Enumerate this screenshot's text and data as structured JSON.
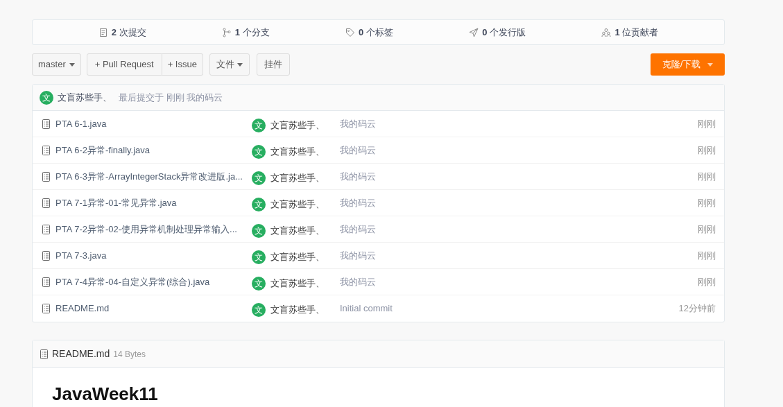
{
  "stats": [
    {
      "kind": "commits",
      "count": "2",
      "label": "次提交"
    },
    {
      "kind": "branches",
      "count": "1",
      "label": "个分支"
    },
    {
      "kind": "tags",
      "count": "0",
      "label": "个标签"
    },
    {
      "kind": "releases",
      "count": "0",
      "label": "个发行版"
    },
    {
      "kind": "contributors",
      "count": "1",
      "label": "位贡献者"
    }
  ],
  "toolbar": {
    "branch": "master",
    "pull_request": "+ Pull Request",
    "issue": "+ Issue",
    "files": "文件",
    "widgets": "挂件",
    "clone": "克隆/下载"
  },
  "last_commit": {
    "avatar": "文",
    "author": "文盲苏些手、",
    "info": "最后提交于 刚刚 我的码云"
  },
  "files": [
    {
      "name": "PTA 6-1.java",
      "avatar": "文",
      "author": "文盲苏些手、",
      "message": "我的码云",
      "time": "刚刚"
    },
    {
      "name": "PTA 6-2异常-finally.java",
      "avatar": "文",
      "author": "文盲苏些手、",
      "message": "我的码云",
      "time": "刚刚"
    },
    {
      "name": "PTA 6-3异常-ArrayIntegerStack异常改进版.ja...",
      "avatar": "文",
      "author": "文盲苏些手、",
      "message": "我的码云",
      "time": "刚刚"
    },
    {
      "name": "PTA 7-1异常-01-常见异常.java",
      "avatar": "文",
      "author": "文盲苏些手、",
      "message": "我的码云",
      "time": "刚刚"
    },
    {
      "name": "PTA 7-2异常-02-使用异常机制处理异常输入...",
      "avatar": "文",
      "author": "文盲苏些手、",
      "message": "我的码云",
      "time": "刚刚"
    },
    {
      "name": "PTA 7-3.java",
      "avatar": "文",
      "author": "文盲苏些手、",
      "message": "我的码云",
      "time": "刚刚"
    },
    {
      "name": "PTA 7-4异常-04-自定义异常(综合).java",
      "avatar": "文",
      "author": "文盲苏些手、",
      "message": "我的码云",
      "time": "刚刚"
    },
    {
      "name": "README.md",
      "avatar": "文",
      "author": "文盲苏些手、",
      "message": "Initial commit",
      "time": "12分钟前"
    }
  ],
  "readme": {
    "filename": "README.md",
    "size": "14 Bytes",
    "heading": "JavaWeek11"
  }
}
